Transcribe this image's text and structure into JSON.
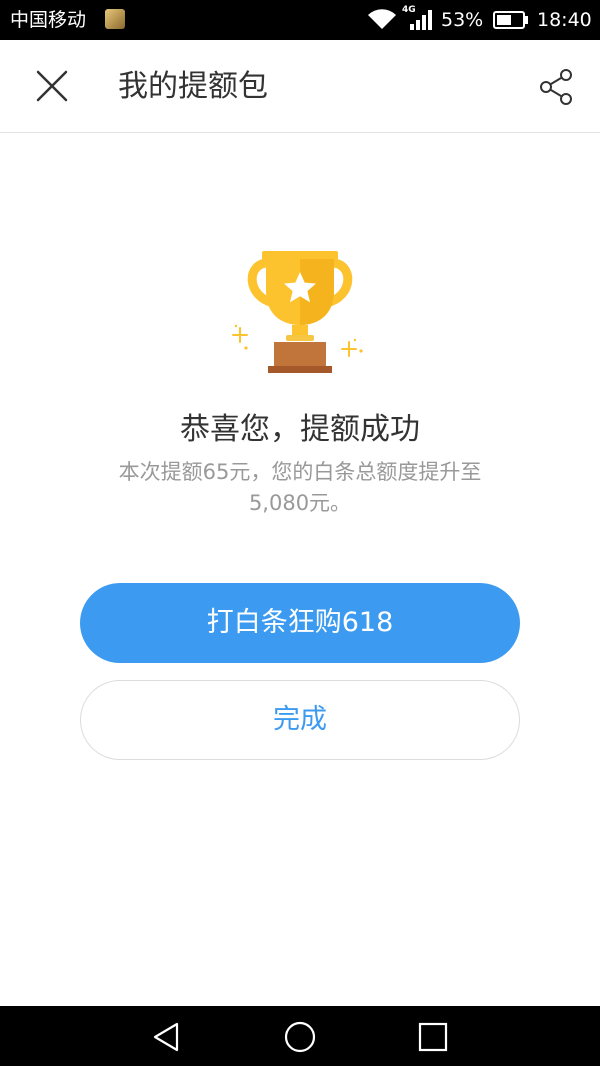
{
  "status_bar": {
    "carrier": "中国移动",
    "network_type": "4G",
    "battery_percent": "53%",
    "time": "18:40",
    "icons": [
      "app-notification-icon",
      "wifi-icon",
      "signal-icon",
      "battery-icon"
    ]
  },
  "header": {
    "title": "我的提额包",
    "icons": [
      "close-icon",
      "share-icon"
    ]
  },
  "main": {
    "illustration": "trophy-icon",
    "title": "恭喜您，提额成功",
    "description": "本次提额65元，您的白条总额度提升至5,080元。",
    "primary_button": "打白条狂购618",
    "secondary_button": "完成"
  },
  "nav_bar": {
    "icons": [
      "back-icon",
      "home-icon",
      "recent-apps-icon"
    ]
  },
  "colors": {
    "accent": "#3c9bf1",
    "status_bar_bg": "#000000",
    "title_text": "#333333",
    "secondary_text": "#999999",
    "trophy_gold": "#fcc32f",
    "trophy_base": "#c2753a"
  }
}
